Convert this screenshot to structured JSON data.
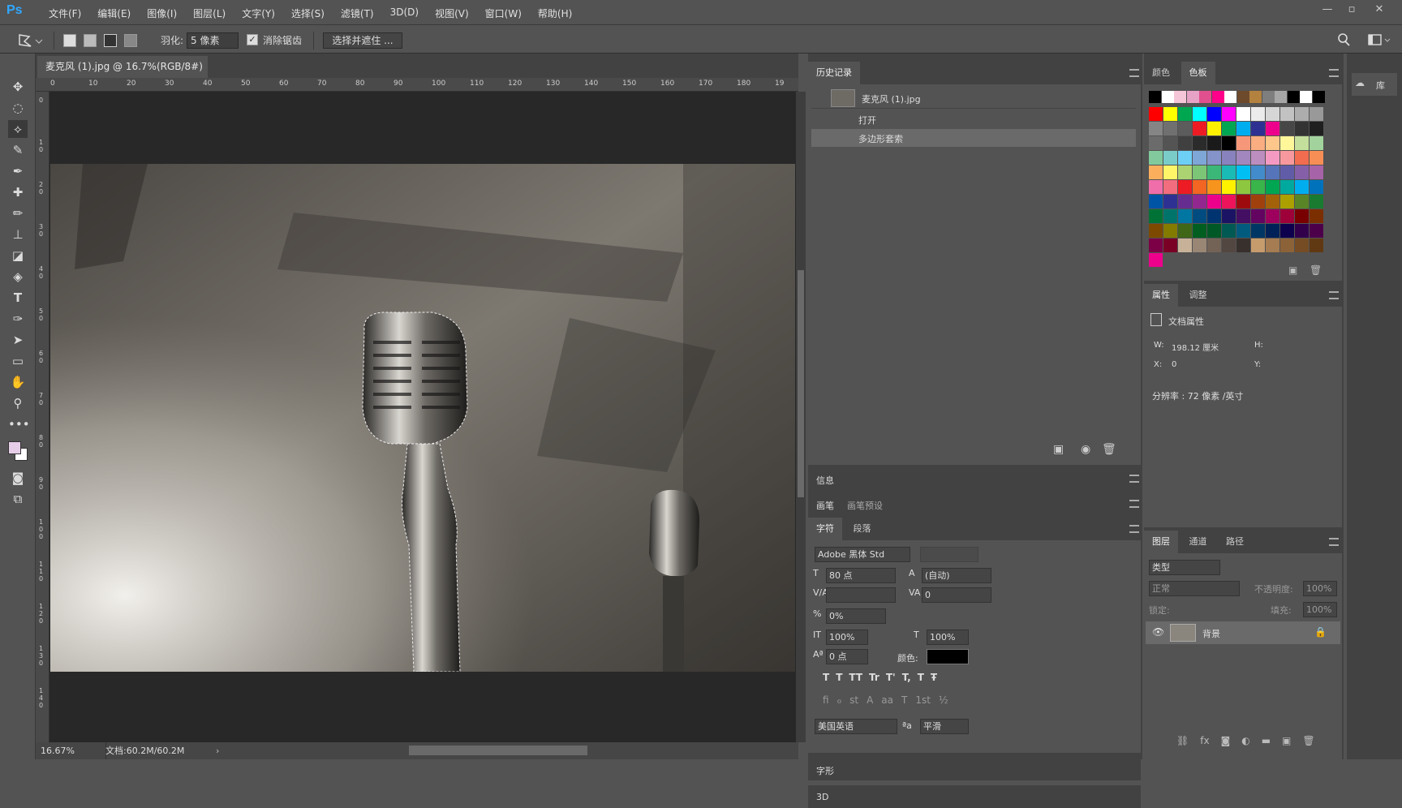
{
  "app": {
    "logo": "Ps"
  },
  "menu": [
    "文件(F)",
    "编辑(E)",
    "图像(I)",
    "图层(L)",
    "文字(Y)",
    "选择(S)",
    "滤镜(T)",
    "3D(D)",
    "视图(V)",
    "窗口(W)",
    "帮助(H)"
  ],
  "window_controls": {
    "minimize": "—",
    "restore": "▫",
    "close": "✕"
  },
  "options": {
    "feather_label": "羽化:",
    "feather_value": "5 像素",
    "antialias_label": "消除锯齿",
    "select_mask_button": "选择并遮住 ..."
  },
  "document": {
    "tab_title": "麦克风 (1).jpg @ 16.7%(RGB/8#)",
    "tab_close": "×",
    "zoom": "16.67%",
    "doc_size": "文档:60.2M/60.2M",
    "ruler_top": [
      "0",
      "10",
      "20",
      "30",
      "40",
      "50",
      "60",
      "70",
      "80",
      "90",
      "100",
      "110",
      "120",
      "130",
      "140",
      "150",
      "160",
      "170",
      "180",
      "19"
    ],
    "ruler_left": [
      "0",
      "1 0",
      "2 0",
      "3 0",
      "4 0",
      "5 0",
      "6 0",
      "7 0",
      "8 0",
      "9 0",
      "1 0 0",
      "1 1 0",
      "1 2 0",
      "1 3 0",
      "1 4 0"
    ]
  },
  "history": {
    "tab": "历史记录",
    "snapshot": "麦克风 (1).jpg",
    "items": [
      "打开",
      "多边形套索"
    ]
  },
  "info_panel": {
    "tab": "信息"
  },
  "brush_panel": {
    "tabs": [
      "画笔",
      "画笔预设"
    ]
  },
  "character": {
    "tabs": [
      "字符",
      "段落"
    ],
    "font": "Adobe 黑体 Std",
    "size": "80 点",
    "leading": "(自动)",
    "kerning": "",
    "tracking": "0",
    "tsume": "0%",
    "vscale": "100%",
    "hscale": "100%",
    "baseline": "0 点",
    "color_label": "颜色:",
    "color": "#000000",
    "style_buttons": [
      "T",
      "T",
      "TT",
      "Tr",
      "T'",
      "T,",
      "T",
      "Ŧ"
    ],
    "ot_buttons": [
      "fi",
      "ℴ",
      "st",
      "A",
      "aa",
      "T",
      "1st",
      "½"
    ],
    "language": "美国英语",
    "aa_label": "ªa",
    "antialias": "平滑"
  },
  "glyphs_panel": {
    "tab": "字形"
  },
  "threed_panel": {
    "tab": "3D"
  },
  "swatches": {
    "tabs": [
      "颜色",
      "色板"
    ],
    "rows": [
      [
        "#000000",
        "#ffffff",
        "#f5c6d8",
        "#e7a3c6",
        "#e0508e",
        "#ff008a",
        "#ffffff",
        "#6d4a2c",
        "#b3823f",
        "#7e7e7e",
        "#a6a6a6",
        "#000000",
        "#ffffff",
        "#000000"
      ],
      [
        "#ff0000",
        "#ffff00",
        "#00a650",
        "#00ffff",
        "#0000ff",
        "#ff00ff",
        "#ffffff",
        "#ebebeb",
        "#d6d6d6",
        "#c2c2c2",
        "#adadad",
        "#999999"
      ],
      [
        "#858585",
        "#707070",
        "#5c5c5c",
        "#ed1c24",
        "#fff200",
        "#00a651",
        "#00aeef",
        "#2e3192",
        "#ec008c",
        "#474747",
        "#333333",
        "#1f1f1f"
      ],
      [
        "#6b6b6b",
        "#545454",
        "#404040",
        "#2b2b2b",
        "#1a1a1a",
        "#000000",
        "#f7977a",
        "#f9ad81",
        "#fdc68a",
        "#fff79a",
        "#c4df9b",
        "#a3d39c"
      ],
      [
        "#82ca9d",
        "#7accc8",
        "#6dcff6",
        "#7ea7d8",
        "#8493ca",
        "#8882be",
        "#a187be",
        "#bc8dbf",
        "#f49ac2",
        "#f6989d",
        "#f26c4f",
        "#f68e55"
      ],
      [
        "#fbaf5d",
        "#fff568",
        "#acd372",
        "#7cc576",
        "#3bb878",
        "#1abbb4",
        "#00bff3",
        "#438ccb",
        "#5574b9",
        "#605ca8",
        "#855fa8",
        "#a763a8"
      ],
      [
        "#f06ea9",
        "#f26d7d",
        "#ed1c24",
        "#f26522",
        "#f7941d",
        "#fff200",
        "#8dc73f",
        "#39b54a",
        "#00a651",
        "#00a99d",
        "#00aeef",
        "#0072bc"
      ],
      [
        "#0054a6",
        "#2e3192",
        "#662d91",
        "#92278f",
        "#ec008c",
        "#ed145b",
        "#9e0b0f",
        "#a0410d",
        "#a3620a",
        "#aba000",
        "#598527",
        "#197b30"
      ],
      [
        "#007236",
        "#00746b",
        "#0076a3",
        "#004b80",
        "#003471",
        "#1b1464",
        "#440e62",
        "#630460",
        "#9e005d",
        "#9e0039",
        "#790000",
        "#7b2e00"
      ],
      [
        "#7d4900",
        "#827b00",
        "#406618",
        "#005e20",
        "#005826",
        "#005952",
        "#005b7f",
        "#003663",
        "#002157",
        "#0d004c",
        "#32004b",
        "#4b0049"
      ],
      [
        "#7b0046",
        "#7a0026",
        "#c7b299",
        "#998675",
        "#736357",
        "#534741",
        "#37302d",
        "#c69c6d",
        "#a67c52",
        "#8c6239",
        "#754c24",
        "#603913"
      ],
      [
        "#ec008c"
      ]
    ]
  },
  "properties": {
    "tabs": [
      "属性",
      "调整"
    ],
    "title": "文档属性",
    "w_label": "W:",
    "w_value": "198.12 厘米",
    "h_label": "H:",
    "x_label": "X:",
    "x_value": "0",
    "y_label": "Y:",
    "resolution": "分辨率 : 72 像素 /英寸"
  },
  "layers": {
    "tabs": [
      "图层",
      "通道",
      "路径"
    ],
    "filter_placeholder": "类型",
    "blend_mode": "正常",
    "opacity_label": "不透明度:",
    "opacity": "100%",
    "lock_label": "锁定:",
    "fill_label": "填充:",
    "fill": "100%",
    "items": [
      {
        "name": "背景"
      }
    ]
  },
  "libraries": {
    "label": "库"
  }
}
